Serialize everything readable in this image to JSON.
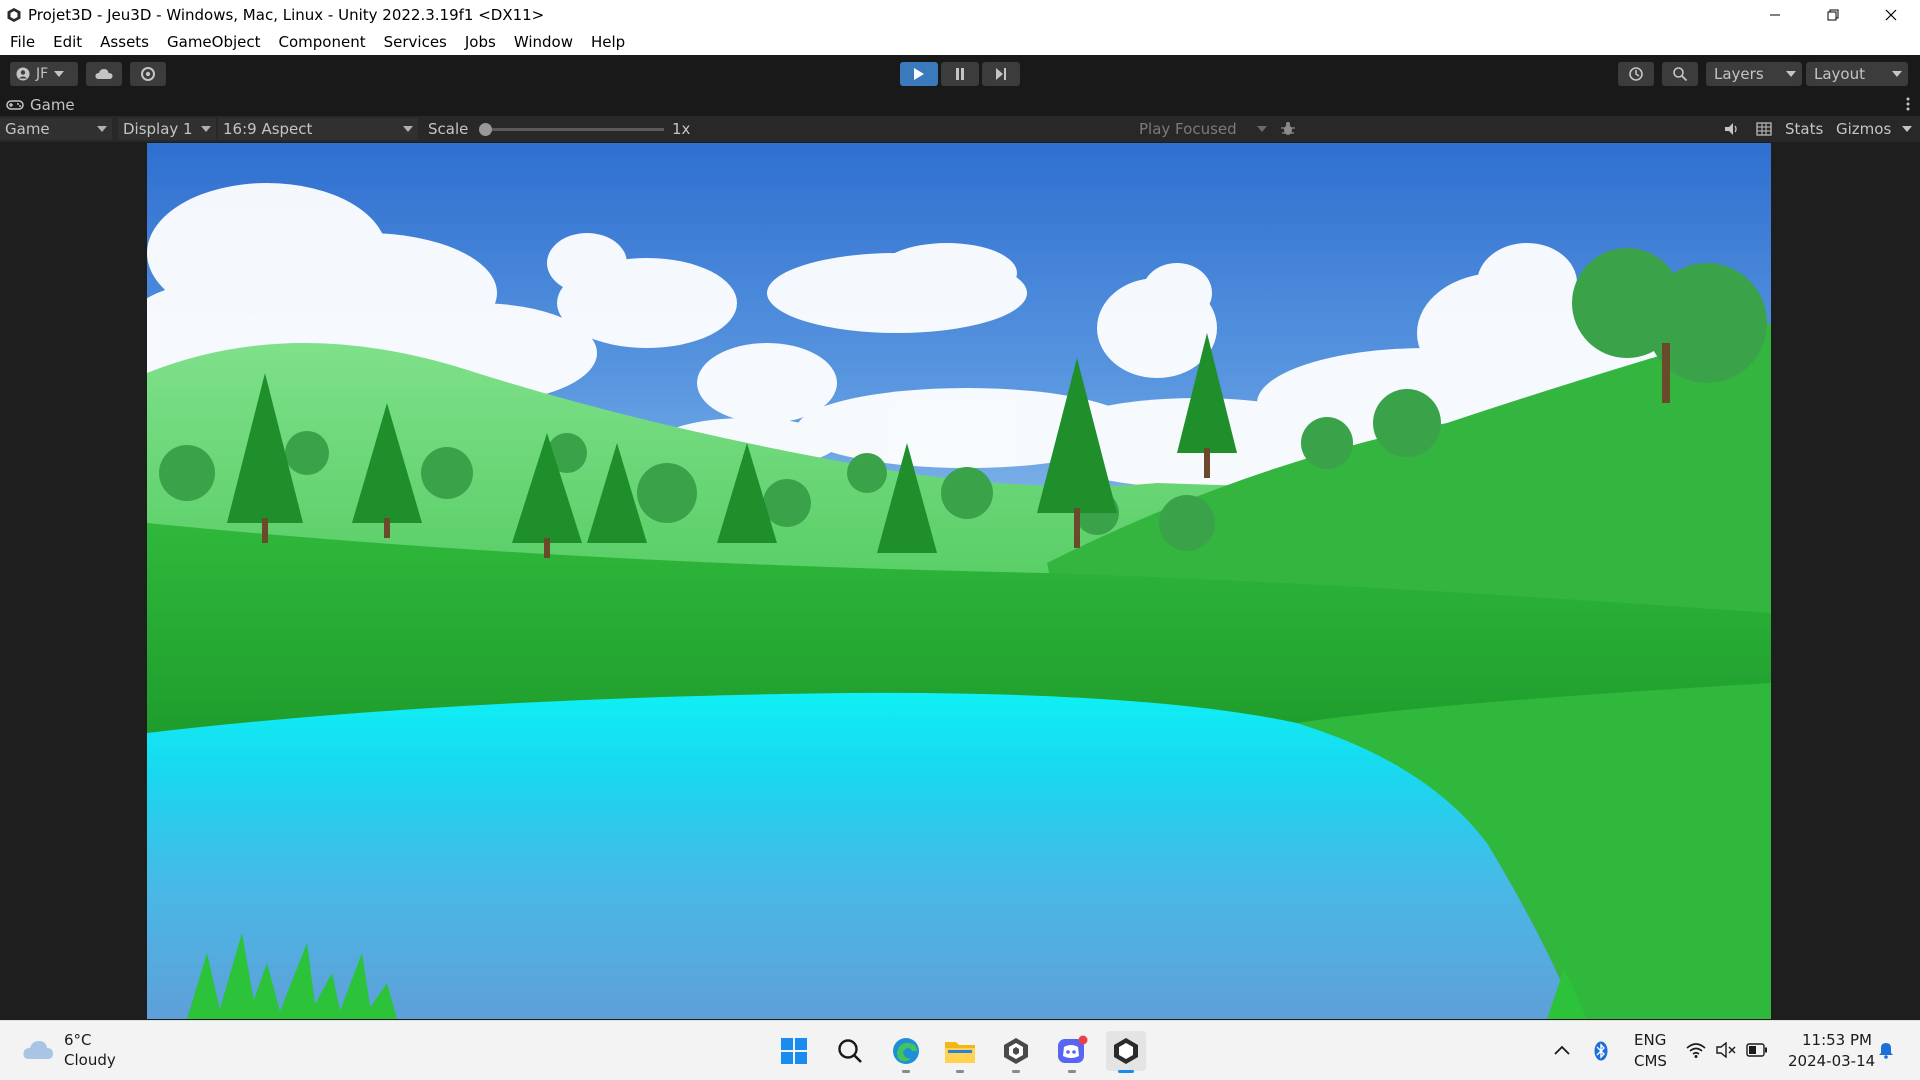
{
  "window": {
    "title": "Projet3D - Jeu3D - Windows, Mac, Linux - Unity 2022.3.19f1 <DX11>"
  },
  "menu": [
    "File",
    "Edit",
    "Assets",
    "GameObject",
    "Component",
    "Services",
    "Jobs",
    "Window",
    "Help"
  ],
  "toolbar": {
    "account_label": "JF",
    "layers_label": "Layers",
    "layout_label": "Layout"
  },
  "tab": {
    "label": "Game"
  },
  "game_toolbar": {
    "mode": "Game",
    "display": "Display 1",
    "aspect": "16:9 Aspect",
    "scale_label": "Scale",
    "scale_value": "1x",
    "scale_level": 0,
    "play_focused": "Play Focused",
    "stats": "Stats",
    "gizmos": "Gizmos"
  },
  "taskbar": {
    "weather_temp": "6°C",
    "weather_desc": "Cloudy",
    "lang_top": "ENG",
    "lang_bottom": "CMS",
    "time": "11:53 PM",
    "date": "2024-03-14"
  },
  "colors": {
    "sky_top": "#2f6fd0",
    "sky_bottom": "#a9d2f2",
    "hills": "#45c94a",
    "water": "#19d7ef",
    "play_active": "#3a79bb"
  }
}
